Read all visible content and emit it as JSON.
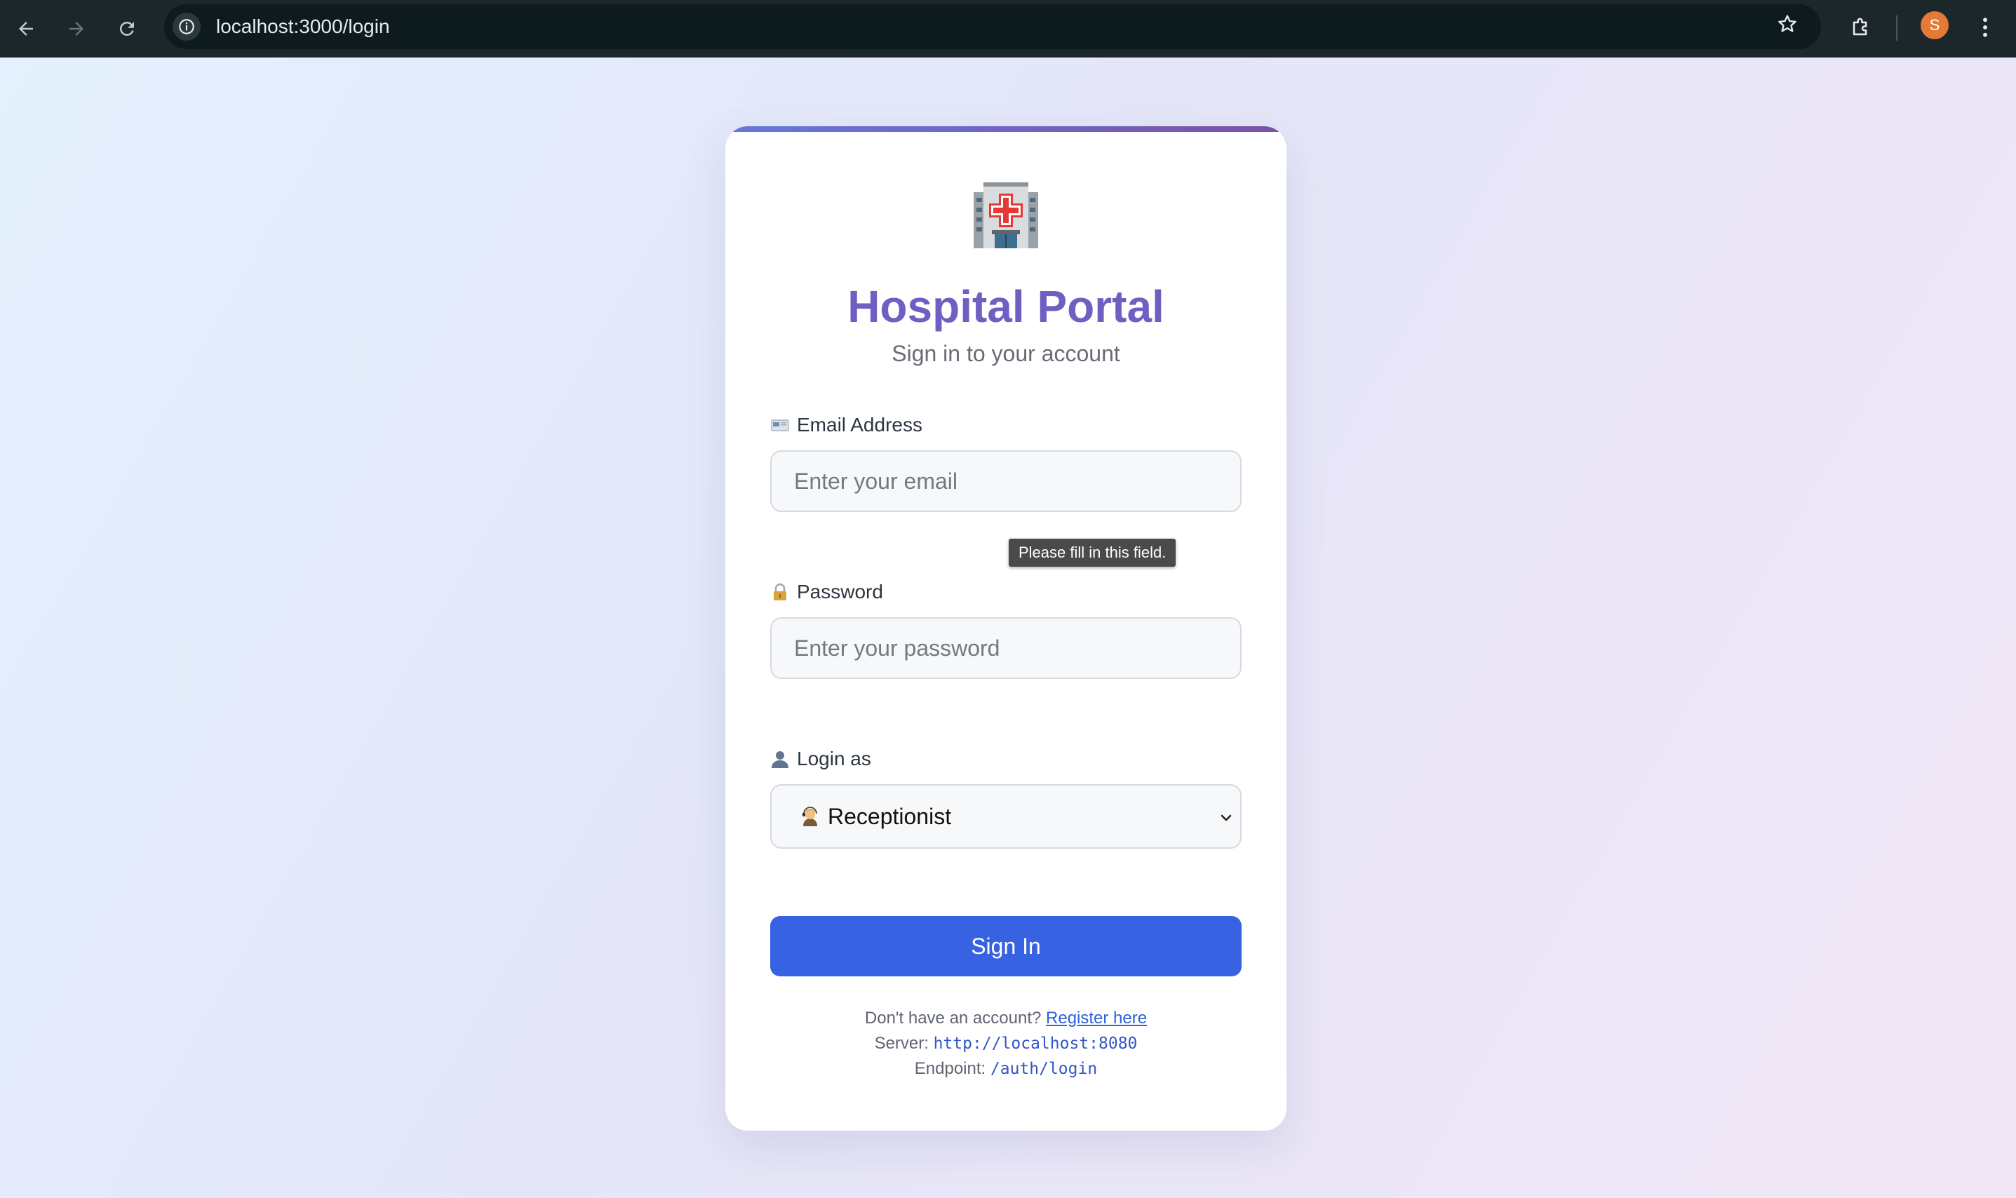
{
  "browser": {
    "url": "localhost:3000/login",
    "profile_initial": "S",
    "colors": {
      "chrome": "#1b272b",
      "omnibox": "#0d1a1e",
      "avatar": "#e37a35"
    }
  },
  "login": {
    "logo_icon": "hospital-emoji",
    "title": "Hospital Portal",
    "subtitle": "Sign in to your account",
    "email": {
      "icon": "envelope-emoji",
      "label": "Email Address",
      "placeholder": "Enter your email",
      "value": ""
    },
    "validation_tooltip": "Please fill in this field.",
    "password": {
      "icon": "lock-emoji",
      "label": "Password",
      "placeholder": "Enter your password",
      "value": ""
    },
    "role": {
      "icon": "user-silhouette-emoji",
      "label": "Login as",
      "selected_icon": "receptionist-emoji",
      "selected": "Receptionist"
    },
    "submit_label": "Sign In",
    "footer": {
      "register_prompt": "Don't have an account?",
      "register_link": "Register here",
      "server_label": "Server:",
      "server_value": "http://localhost:8080",
      "endpoint_label": "Endpoint:",
      "endpoint_value": "/auth/login"
    },
    "colors": {
      "title": "#6e5fc2",
      "button": "#3762e2",
      "link": "#3060d8",
      "topbar_start": "#6677dd",
      "topbar_end": "#7a52a6"
    }
  }
}
